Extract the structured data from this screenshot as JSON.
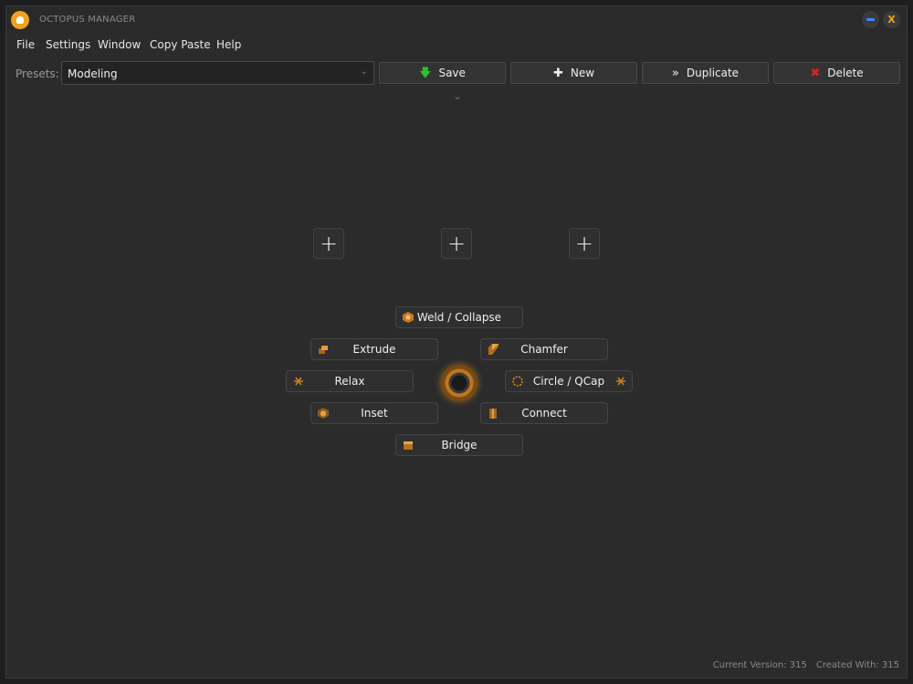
{
  "app": {
    "title": "OCTOPUS MANAGER",
    "close_glyph": "X"
  },
  "menu": [
    "File",
    "Settings",
    "Window",
    "Copy Paste",
    "Help"
  ],
  "presets": {
    "label": "Presets:",
    "selected": "Modeling"
  },
  "toolbar": {
    "save": "Save",
    "new": "New",
    "duplicate": "Duplicate",
    "delete": "Delete"
  },
  "plus_slots": [
    "+",
    "+",
    "+"
  ],
  "radial": {
    "weld_collapse": "Weld / Collapse",
    "extrude": "Extrude",
    "chamfer": "Chamfer",
    "relax": "Relax",
    "circle_qcap": "Circle / QCap",
    "inset": "Inset",
    "connect": "Connect",
    "bridge": "Bridge"
  },
  "footer": {
    "current_version": "Current Version: 315",
    "created_with": "Created With: 315"
  },
  "colors": {
    "accent": "#f0a21f",
    "save_icon": "#2fbf2f",
    "delete_icon": "#e02020",
    "minimize": "#2f8fff"
  }
}
